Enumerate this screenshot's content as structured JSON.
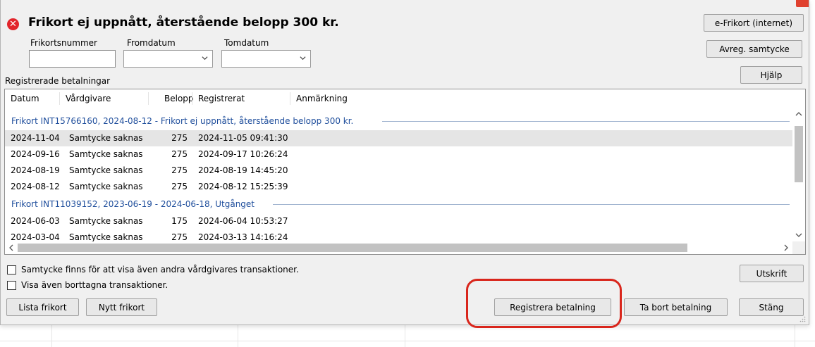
{
  "status": {
    "icon": "error-x-icon",
    "icon_color": "#e2252b",
    "message": "Frikort ej uppnått, återstående belopp 300 kr."
  },
  "filters": {
    "card_number_label": "Frikortsnummer",
    "card_number_value": "",
    "from_label": "Fromdatum",
    "from_value": "",
    "to_label": "Tomdatum",
    "to_value": ""
  },
  "buttons": {
    "efrikort": "e-Frikort (internet)",
    "revoke_consent": "Avreg. samtycke",
    "help": "Hjälp",
    "print": "Utskrift",
    "list_cards": "Lista frikort",
    "new_card": "Nytt frikort",
    "register_payment": "Registrera betalning",
    "remove_payment": "Ta bort betalning",
    "close": "Stäng"
  },
  "payments_label": "Registrerade betalningar",
  "columns": [
    "Datum",
    "Vårdgivare",
    "Belopp",
    "Registrerat",
    "Anmärkning"
  ],
  "groups": [
    {
      "title": "Frikort INT15766160, 2024-08-12 - Frikort ej uppnått, återstående belopp 300 kr.",
      "rows": [
        {
          "date": "2024-11-04",
          "provider": "Samtycke saknas",
          "amount": "275",
          "registered": "2024-11-05 09:41:30",
          "note": "",
          "selected": true
        },
        {
          "date": "2024-09-16",
          "provider": "Samtycke saknas",
          "amount": "275",
          "registered": "2024-09-17 10:26:24",
          "note": ""
        },
        {
          "date": "2024-08-19",
          "provider": "Samtycke saknas",
          "amount": "275",
          "registered": "2024-08-19 14:45:20",
          "note": ""
        },
        {
          "date": "2024-08-12",
          "provider": "Samtycke saknas",
          "amount": "275",
          "registered": "2024-08-12 15:25:39",
          "note": ""
        }
      ]
    },
    {
      "title": "Frikort INT11039152, 2023-06-19 - 2024-06-18, Utgånget",
      "rows": [
        {
          "date": "2024-06-03",
          "provider": "Samtycke saknas",
          "amount": "175",
          "registered": "2024-06-04 10:53:27",
          "note": ""
        },
        {
          "date": "2024-03-04",
          "provider": "Samtycke saknas",
          "amount": "275",
          "registered": "2024-03-13 14:16:24",
          "note": ""
        }
      ]
    }
  ],
  "checkboxes": {
    "consent": {
      "label": "Samtycke finns för att visa även andra vårdgivares transaktioner.",
      "checked": false
    },
    "show_removed": {
      "label": "Visa även borttagna transaktioner.",
      "checked": false
    }
  },
  "colors": {
    "group_text": "#1f4e9c",
    "highlight": "#d9261c"
  }
}
